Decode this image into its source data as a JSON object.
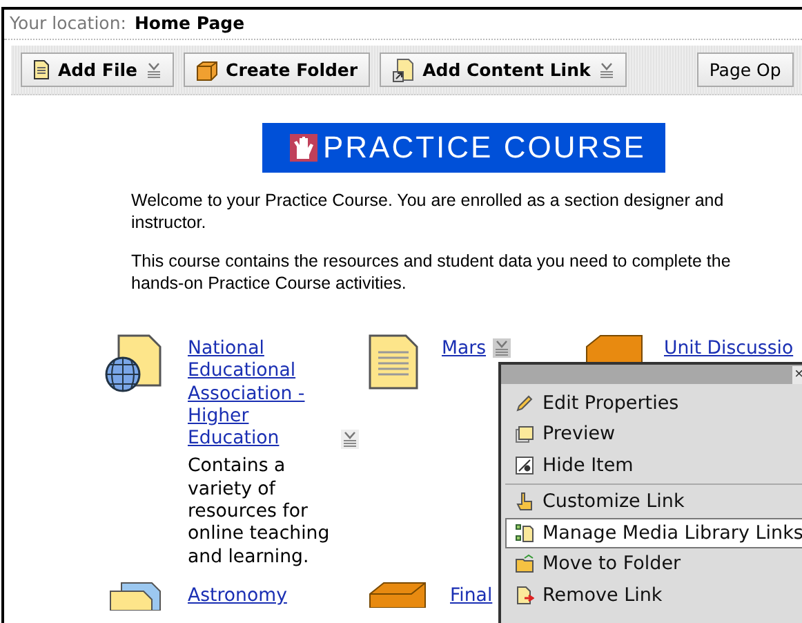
{
  "location": {
    "label": "Your location:",
    "page": "Home Page"
  },
  "toolbar": [
    {
      "label": "Add File",
      "kind": "file",
      "dropdown": true
    },
    {
      "label": "Create Folder",
      "kind": "folder",
      "dropdown": false
    },
    {
      "label": "Add Content Link",
      "kind": "link",
      "dropdown": true
    },
    {
      "label": "Page Op",
      "kind": "plain",
      "dropdown": false
    }
  ],
  "banner": {
    "title": "PRACTICE COURSE"
  },
  "intro": [
    "Welcome to your Practice Course.  You are enrolled as a section designer and instructor.",
    "This course contains the resources and student data you need to complete the hands-on Practice Course activities."
  ],
  "items": [
    {
      "kind": "web",
      "title": "National Educational Association - Higher Education",
      "menu": true,
      "menu_open": false,
      "description": "Contains a variety of resources for online teaching and learning."
    },
    {
      "kind": "document",
      "title": "Mars",
      "menu": true,
      "menu_open": true
    },
    {
      "kind": "discussion",
      "title": "Unit Discussio",
      "menu": false
    },
    {
      "kind": "documents",
      "title": "Astronomy",
      "menu": false
    },
    {
      "kind": "project",
      "title": "Final",
      "menu": false
    }
  ],
  "context_menu": {
    "close": "×",
    "groups": [
      [
        {
          "label": "Edit Properties",
          "kind": "edit",
          "selected": false
        },
        {
          "label": "Preview",
          "kind": "preview",
          "selected": false
        },
        {
          "label": "Hide Item",
          "kind": "hide",
          "selected": false
        }
      ],
      [
        {
          "label": "Customize Link",
          "kind": "customize",
          "selected": false
        },
        {
          "label": "Manage Media Library Links",
          "kind": "media",
          "selected": true
        },
        {
          "label": "Move to Folder",
          "kind": "move",
          "selected": false
        },
        {
          "label": "Remove Link",
          "kind": "remove",
          "selected": false
        }
      ]
    ]
  }
}
